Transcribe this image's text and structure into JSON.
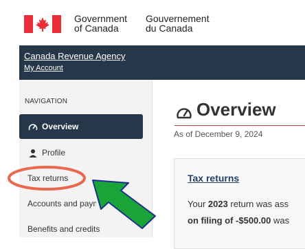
{
  "government": {
    "english_line1": "Government",
    "english_line2": "of Canada",
    "french_line1": "Gouvernement",
    "french_line2": "du Canada"
  },
  "agency": {
    "name": "Canada Revenue Agency",
    "account": "My Account"
  },
  "sidebar": {
    "heading": "NAVIGATION",
    "items": [
      {
        "label": "Overview",
        "icon": "speedometer-icon",
        "active": true
      },
      {
        "label": "Profile",
        "icon": "person-icon"
      },
      {
        "label": "Tax returns"
      },
      {
        "label": "Accounts and payments"
      },
      {
        "label": "Benefits and credits"
      }
    ]
  },
  "main": {
    "title": "Overview",
    "title_icon": "speedometer-icon",
    "as_of": "As of December 9, 2024",
    "card": {
      "title": "Tax returns",
      "line1_pre": "Your ",
      "line1_year": "2023",
      "line1_post": " return was ass",
      "line2_pre": "on filing of -$500.00",
      "line2_post": " was"
    }
  },
  "colors": {
    "agency_bar": "#26374a",
    "active_nav": "#26374a",
    "flag_red": "#eb2d37",
    "highlight_circle": "#e8694f",
    "arrow_fill": "#1aa336",
    "arrow_stroke": "#1c2f8f",
    "title_rule": "#af3c43"
  }
}
